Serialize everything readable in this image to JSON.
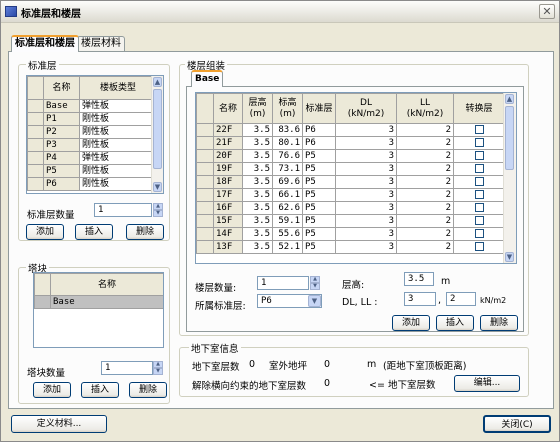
{
  "window": {
    "title": "标准层和楼层"
  },
  "tabs": [
    {
      "label": "标准层和楼层"
    },
    {
      "label": "楼层材料"
    }
  ],
  "std_floor": {
    "group_label": "标准层",
    "columns": [
      "名称",
      "楼板类型"
    ],
    "rows": [
      {
        "name": "Base",
        "type": "弹性板"
      },
      {
        "name": "P1",
        "type": "刚性板"
      },
      {
        "name": "P2",
        "type": "刚性板"
      },
      {
        "name": "P3",
        "type": "刚性板"
      },
      {
        "name": "P4",
        "type": "弹性板"
      },
      {
        "name": "P5",
        "type": "刚性板"
      },
      {
        "name": "P6",
        "type": "刚性板"
      }
    ],
    "count_label": "标准层数量",
    "count_value": "1",
    "add": "添加",
    "insert": "插入",
    "delete": "删除"
  },
  "tower": {
    "group_label": "塔块",
    "column": "名称",
    "rows": [
      {
        "name": "Base"
      }
    ],
    "count_label": "塔块数量",
    "count_value": "1",
    "add": "添加",
    "insert": "插入",
    "delete": "删除"
  },
  "floors": {
    "group_label": "楼层组装",
    "tab": "Base",
    "columns": [
      "名称",
      "层高\n(m)",
      "标高\n(m)",
      "标准层",
      "DL\n(kN/m2)",
      "LL\n(kN/m2)",
      "转换层"
    ],
    "rows": [
      {
        "name": "22F",
        "h": "3.5",
        "elev": "83.6",
        "std": "P6",
        "dl": "3",
        "ll": "2",
        "transfer": false
      },
      {
        "name": "21F",
        "h": "3.5",
        "elev": "80.1",
        "std": "P6",
        "dl": "3",
        "ll": "2",
        "transfer": false
      },
      {
        "name": "20F",
        "h": "3.5",
        "elev": "76.6",
        "std": "P5",
        "dl": "3",
        "ll": "2",
        "transfer": false
      },
      {
        "name": "19F",
        "h": "3.5",
        "elev": "73.1",
        "std": "P5",
        "dl": "3",
        "ll": "2",
        "transfer": false
      },
      {
        "name": "18F",
        "h": "3.5",
        "elev": "69.6",
        "std": "P5",
        "dl": "3",
        "ll": "2",
        "transfer": false
      },
      {
        "name": "17F",
        "h": "3.5",
        "elev": "66.1",
        "std": "P5",
        "dl": "3",
        "ll": "2",
        "transfer": false
      },
      {
        "name": "16F",
        "h": "3.5",
        "elev": "62.6",
        "std": "P5",
        "dl": "3",
        "ll": "2",
        "transfer": false
      },
      {
        "name": "15F",
        "h": "3.5",
        "elev": "59.1",
        "std": "P5",
        "dl": "3",
        "ll": "2",
        "transfer": false
      },
      {
        "name": "14F",
        "h": "3.5",
        "elev": "55.6",
        "std": "P5",
        "dl": "3",
        "ll": "2",
        "transfer": false
      },
      {
        "name": "13F",
        "h": "3.5",
        "elev": "52.1",
        "std": "P5",
        "dl": "3",
        "ll": "2",
        "transfer": false
      }
    ],
    "count_label": "楼层数量:",
    "count_value": "1",
    "height_label": "层高:",
    "height_value": "3.5",
    "height_unit": "m",
    "std_label": "所属标准层:",
    "std_value": "P6",
    "dlll_label": "DL, LL :",
    "dl_value": "3",
    "ll_value": "2",
    "dlll_unit": "kN/m2",
    "add": "添加",
    "insert": "插入",
    "delete": "删除"
  },
  "basement": {
    "group_label": "地下室信息",
    "count_label": "地下室层数",
    "count_value": "0",
    "outdoor_label": "室外地坪",
    "outdoor_value": "0",
    "outdoor_unit": "m",
    "outdoor_note": "(距地下室顶板距离)",
    "release_label": "解除横向约束的地下室层数",
    "release_value": "0",
    "arrow_label": "<= 地下室层数",
    "edit": "编辑..."
  },
  "footer": {
    "define_material": "定义材料...",
    "close": "关闭(C)"
  }
}
